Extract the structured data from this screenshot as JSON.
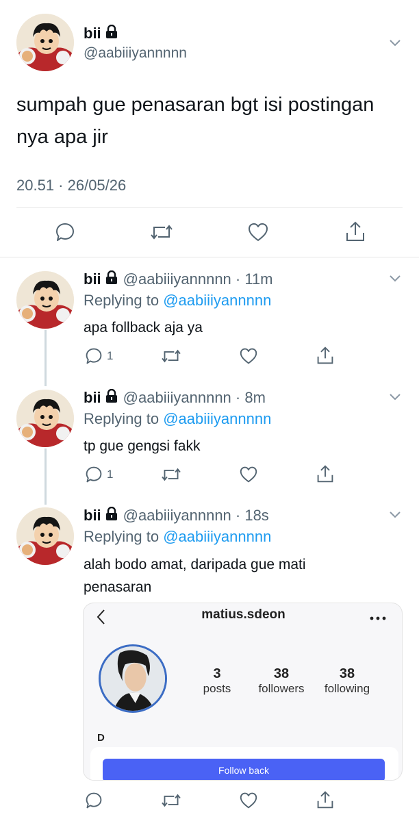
{
  "main_tweet": {
    "name": "bii",
    "handle": "@aabiiiyannnnn",
    "text": "sumpah gue penasaran bgt isi postingan nya apa jir",
    "timestamp": "20.51 · 26/05/26",
    "icons": [
      "reply-icon",
      "retweet-icon",
      "like-icon",
      "share-icon"
    ]
  },
  "replies": [
    {
      "name": "bii",
      "handle": "@aabiiiyannnnn · 11m",
      "replying_prefix": "Replying to",
      "replying_to": "@aabiiiyannnnn",
      "text": "apa follback aja ya",
      "reply_count": "1"
    },
    {
      "name": "bii",
      "handle": "@aabiiiyannnnn · 8m",
      "replying_prefix": "Replying to",
      "replying_to": "@aabiiiyannnnn",
      "text": "tp gue gengsi fakk",
      "reply_count": "1"
    },
    {
      "name": "bii",
      "handle": "@aabiiiyannnnn · 18s",
      "replying_prefix": "Replying to",
      "replying_to": "@aabiiiyannnnn",
      "text": "alah bodo amat, daripada gue mati penasaran",
      "reply_count": ""
    }
  ],
  "embedded_profile": {
    "username": "matius.sdeon",
    "stats": [
      {
        "num": "3",
        "label": "posts"
      },
      {
        "num": "38",
        "label": "followers"
      },
      {
        "num": "38",
        "label": "following"
      }
    ],
    "display_name": "D",
    "button_label": "Follow back"
  },
  "colors": {
    "link": "#1d9bf0",
    "muted": "#536471",
    "follow_button": "#4a62f5"
  }
}
